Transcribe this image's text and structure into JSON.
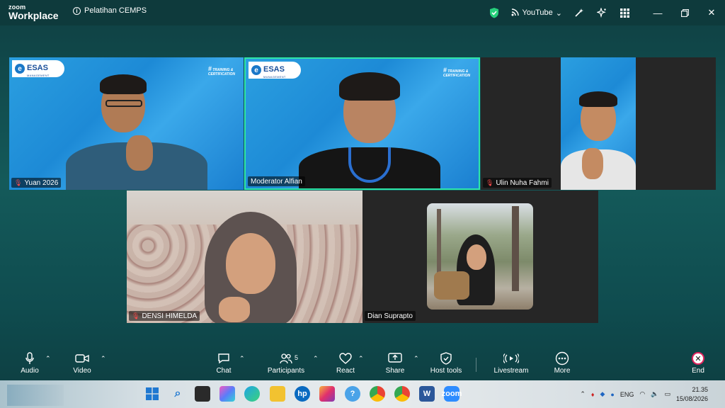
{
  "app": {
    "logo_top": "zoom",
    "logo_bottom": "Workplace",
    "meeting_title": "Pelatihan CEMPS"
  },
  "titlebar": {
    "streaming_label": "YouTube"
  },
  "branding": {
    "esas": "ESAS",
    "esas_sub": "MANAGEMENT",
    "training_line1": "TRAINING &",
    "training_line2": "CERTIFICATION"
  },
  "participants": [
    {
      "name": "Yuan 2026",
      "muted": true
    },
    {
      "name": "Moderator Alfian",
      "muted": false
    },
    {
      "name": "Ulin Nuha Fahmi",
      "muted": true
    },
    {
      "name": "DENSI HIMELDA",
      "muted": true
    },
    {
      "name": "Dian Suprapto",
      "muted": false
    }
  ],
  "toolbar": {
    "audio": "Audio",
    "video": "Video",
    "chat": "Chat",
    "participants": "Participants",
    "participants_count": "5",
    "react": "React",
    "share": "Share",
    "host_tools": "Host tools",
    "livestream": "Livestream",
    "more": "More",
    "end": "End"
  },
  "tray": {
    "lang": "ENG",
    "time": "21.35",
    "date": "15/08/2026"
  },
  "colors": {
    "active_border": "#2ee6a8",
    "end_red": "#e0245e",
    "mute_red": "#ff4b4b"
  }
}
